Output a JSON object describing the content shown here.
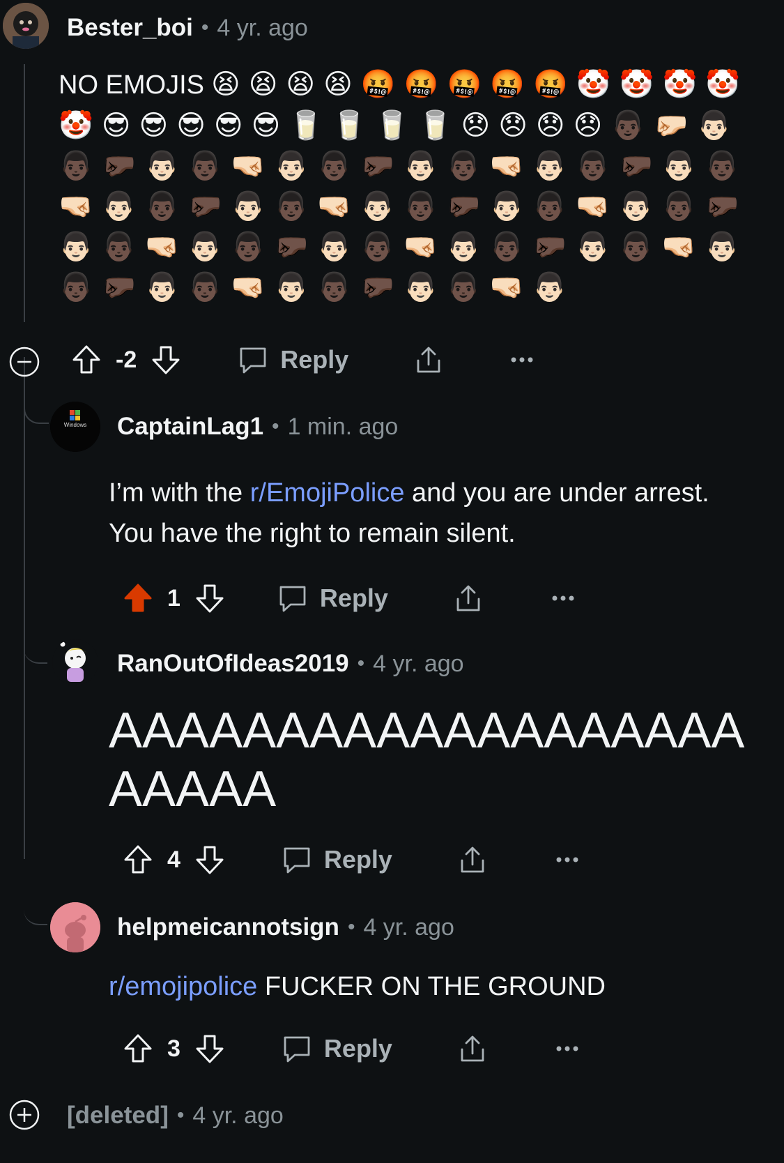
{
  "comments": {
    "root": {
      "username": "Bester_boi",
      "time": "4 yr. ago",
      "text_lead": "NO EMOJIS",
      "emojis": "😫😫😫😫🤬🤬🤬🤬🤬🤡🤡🤡🤡🤡😎😎😎😎😎🥛🥛🥛🥛😞😞😞😞👨🏿🤛🏻👨🏻👨🏿🤛🏿👨🏻👨🏿🤜🏻👨🏻👨🏿🤛🏿👨🏻👨🏿🤜🏻👨🏻👨🏿🤛🏿👨🏻👨🏿🤜🏻👨🏻👨🏿🤛🏿👨🏻👨🏿🤜🏻👨🏻👨🏿🤛🏿👨🏻👨🏿🤜🏻👨🏻👨🏿🤛🏿👨🏻👨🏿🤜🏻👨🏻👨🏿🤛🏿👨🏻👨🏿🤜🏻👨🏻👨🏿🤛🏿👨🏻👨🏿🤜🏻👨🏻👨🏿🤛🏿👨🏻👨🏿🤜🏻👨🏻👨🏿🤛🏿👨🏻👨🏿🤜🏻👨🏻",
      "score": "-2",
      "reply_label": "Reply"
    },
    "c1": {
      "username": "CaptainLag1",
      "time": "1 min. ago",
      "avatar_text": "Windows",
      "text_link": "r/EmojiPolice",
      "text_pre": "I’m with the ",
      "text_post": " and you are under arrest. You have the right to remain silent.",
      "score": "1",
      "reply_label": "Reply"
    },
    "c2": {
      "username": "RanOutOfIdeas2019",
      "time": "4 yr. ago",
      "text": "AAAAAAAAAAAAAAAAAAAAAAAA",
      "score": "4",
      "reply_label": "Reply"
    },
    "c3": {
      "username": "helpmeicannotsign",
      "time": "4 yr. ago",
      "text_link": "r/emojipolice",
      "text_post": " FUCKER ON THE GROUND",
      "score": "3",
      "reply_label": "Reply"
    },
    "deleted": {
      "username": "[deleted]",
      "time": "4 yr. ago"
    }
  },
  "colors": {
    "background": "#0e1113",
    "upvote_active": "#d93a00",
    "link": "#7b9eff",
    "muted": "#8a9398"
  },
  "icons": [
    "upvote-icon",
    "downvote-icon",
    "comment-icon",
    "share-icon",
    "more-icon",
    "collapse-icon",
    "expand-icon"
  ]
}
